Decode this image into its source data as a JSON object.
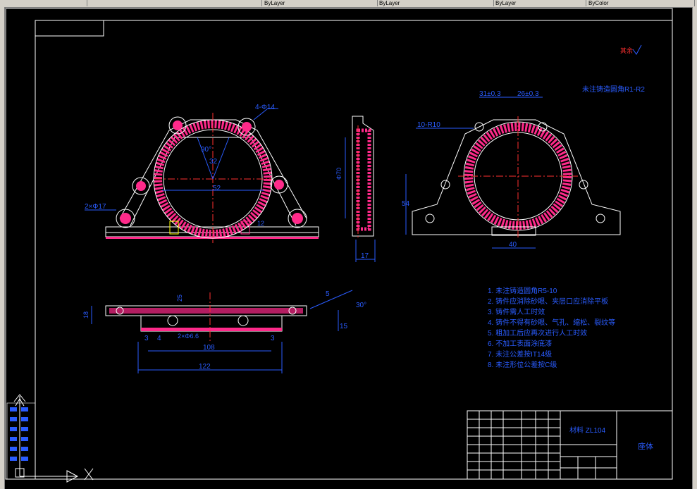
{
  "toolbar": {
    "segments": [
      "",
      "ByLayer",
      "ByLayer",
      "ByLayer",
      "ByColor"
    ]
  },
  "drawing": {
    "roughness_note": "未注铸造圆角R1-R2",
    "surface_symbol_label": "其余",
    "front": {
      "hole_top": "4-Φ14",
      "hole_bottom": "2×Φ17",
      "angle": "90°",
      "radius": "32",
      "width": "52",
      "height": "12"
    },
    "side": {
      "height": "Φ70",
      "width": "17"
    },
    "right": {
      "dim1": "31±0.3",
      "dim2": "26±0.3",
      "radius": "10-R10",
      "height": "54",
      "base": "40"
    },
    "bottom": {
      "dim_left": "4",
      "dim_holes": "2×Φ6.6",
      "dim_108": "108",
      "dim_122": "122",
      "dim_3a": "3",
      "dim_3b": "3",
      "dim_5": "5",
      "dim_15": "15",
      "angle": "30°",
      "dim_left_v": "18",
      "dim_mid_v": "25"
    },
    "notes": [
      "1. 未注铸造圆角R5-10",
      "2. 铸件应消除砂眼、夹层口应消除平板",
      "3. 铸件需人工时效",
      "4. 铸件不得有砂眼、气孔、缩松、裂纹等",
      "5. 粗加工后应再次进行人工时效",
      "6. 不加工表面涂底漆",
      "7. 未注公差按IT14级",
      "8. 未注形位公差按C级"
    ],
    "title_block": {
      "material": "材料 ZL104",
      "part_name": "座体"
    }
  }
}
